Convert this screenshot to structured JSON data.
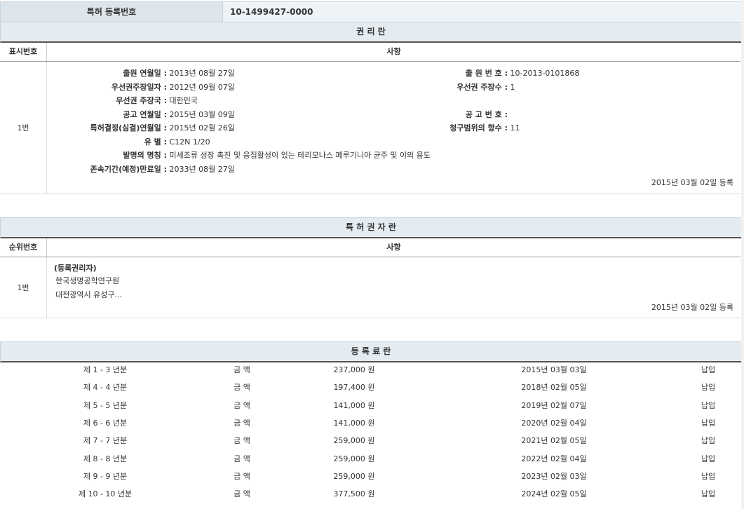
{
  "header": {
    "label": "특허 등록번호",
    "value": "10-1499427-0000"
  },
  "rights": {
    "title": "권 리 란",
    "col_num": "표시번호",
    "col_item": "사항",
    "row_num": "1번",
    "left": [
      {
        "k": "출원 연월일 :",
        "v": "2013년 08월 27일"
      },
      {
        "k": "우선권주장일자 :",
        "v": "2012년 09월 07일"
      },
      {
        "k": "우선권 주장국 :",
        "v": "대한민국"
      },
      {
        "k": "공고 연월일 :",
        "v": "2015년 03월 09일"
      },
      {
        "k": "특허결정(심결)연월일 :",
        "v": "2015년 02월 26일"
      },
      {
        "k": "유 별 :",
        "v": "C12N 1/20"
      },
      {
        "k": "발명의 명칭 :",
        "v": "미세조류 성장 촉진 및 응집활성이 있는 테리모나스 페루기니아 균주 및 이의 용도"
      },
      {
        "k": "존속기간(예정)만료일 :",
        "v": "2033년 08월 27일"
      }
    ],
    "right": [
      {
        "k": "출 원 번 호 :",
        "v": "10-2013-0101868"
      },
      {
        "k": "우선권 주장수 :",
        "v": "1"
      },
      {
        "k": "",
        "v": ""
      },
      {
        "k": "공 고 번 호 :",
        "v": ""
      },
      {
        "k": "청구범위의 항수 :",
        "v": "11"
      }
    ],
    "reg_date": "2015년 03월 02일 등록"
  },
  "holders": {
    "title": "특 허 권 자 란",
    "col_num": "순위번호",
    "col_item": "사항",
    "row_num": "1번",
    "role": "(등록권리자)",
    "name": "한국생명공학연구원",
    "address": "대전광역시 유성구...",
    "reg_date": "2015년 03월 02일 등록"
  },
  "fees": {
    "title": "등 록 료 란",
    "amount_label": "금 액",
    "rows": [
      {
        "term": "제 1 - 3 년분",
        "amount": "237,000 원",
        "date": "2015년 03월 03일",
        "status": "납입"
      },
      {
        "term": "제 4 - 4 년분",
        "amount": "197,400 원",
        "date": "2018년 02월 05일",
        "status": "납입"
      },
      {
        "term": "제 5 - 5 년분",
        "amount": "141,000 원",
        "date": "2019년 02월 07일",
        "status": "납입"
      },
      {
        "term": "제 6 - 6 년분",
        "amount": "141,000 원",
        "date": "2020년 02월 04일",
        "status": "납입"
      },
      {
        "term": "제 7 - 7 년분",
        "amount": "259,000 원",
        "date": "2021년 02월 05일",
        "status": "납입"
      },
      {
        "term": "제 8 - 8 년분",
        "amount": "259,000 원",
        "date": "2022년 02월 04일",
        "status": "납입"
      },
      {
        "term": "제 9 - 9 년분",
        "amount": "259,000 원",
        "date": "2023년 02월 03일",
        "status": "납입"
      },
      {
        "term": "제 10 - 10 년분",
        "amount": "377,500 원",
        "date": "2024년 02월 05일",
        "status": "납입"
      }
    ]
  }
}
